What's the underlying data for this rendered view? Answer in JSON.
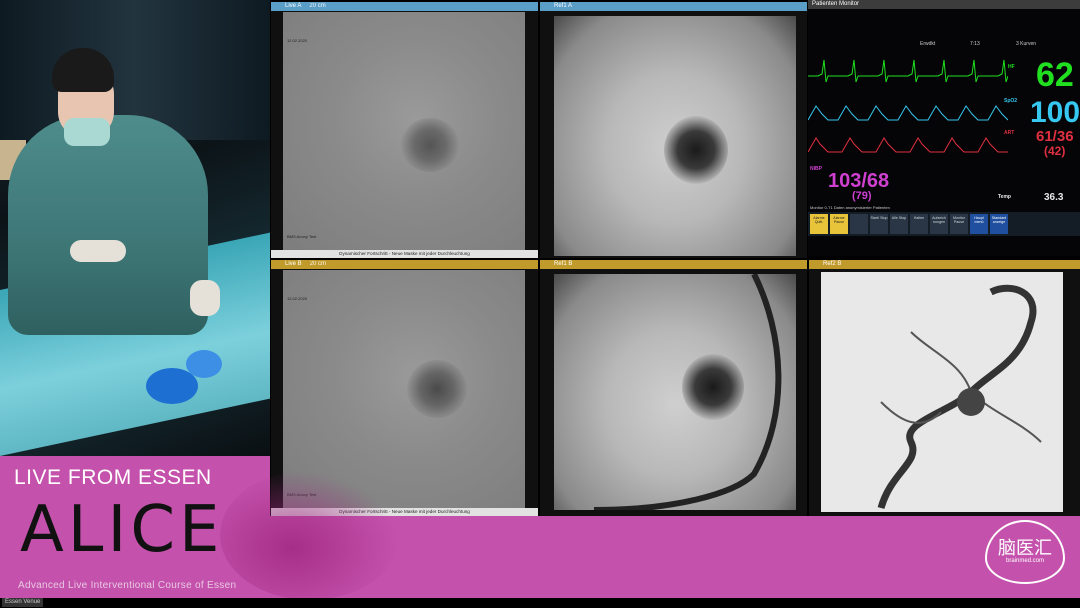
{
  "video": {
    "label": "Live OR camera"
  },
  "panels": {
    "live_a": {
      "title": "Live A",
      "sub": "20 cm",
      "date": "12.02.2020",
      "footer": "Dynamischer Fortschritt - Neue Maske mit jeder Durchleuchtung",
      "anno": "BMS Anony Test"
    },
    "ref1_a": {
      "title": "Ref1 A",
      "sub": ""
    },
    "live_b": {
      "title": "Live B",
      "sub": "20 cm",
      "date": "12.02.2020",
      "footer": "Dynamischer Fortschritt - Neue Maske mit jeder Durchleuchtung",
      "anno": "BMS Anony Test"
    },
    "ref1_b": {
      "title": "Ref1 B",
      "sub": ""
    },
    "ref2_b": {
      "title": "Ref2 B",
      "sub": ""
    }
  },
  "monitor": {
    "title": "Patienten Monitor",
    "strip": [
      "Erwdkt",
      "7:13",
      "3 Kurven"
    ],
    "hr_label": "HF",
    "hr": "62",
    "spo2_label": "SpO2",
    "spo2": "100",
    "art_label": "ART",
    "art": "61/36",
    "art_mean": "(42)",
    "nibp_label": "NIBP",
    "nibp": "103/68",
    "nibp_mean": "(79)",
    "temp_label": "Temp",
    "temp": "36.3",
    "note": "Monitor 0-T1 Daten anonymisierter Patienten",
    "buttons": [
      "Alarme Quitt.",
      "Alarme Pause",
      "",
      "Start/ Stop",
      "Alle Stop",
      "Halten",
      "Aufzeich nungen",
      "Monitor Pause",
      "Haupt menü",
      "Standard anzeige"
    ],
    "colors": {
      "hr": "#20e020",
      "spo2": "#36c8f0",
      "art": "#e03040",
      "nibp": "#d040d0",
      "temp": "#e8e8e8"
    }
  },
  "banner": {
    "live_title": "LIVE FROM ESSEN",
    "logo": "ALICE",
    "subtitle": "Advanced Live Interventional Course of Essen",
    "venue": "Essen Venue",
    "cn_logo": "脑医汇",
    "cn_url": "brainmed.com"
  }
}
